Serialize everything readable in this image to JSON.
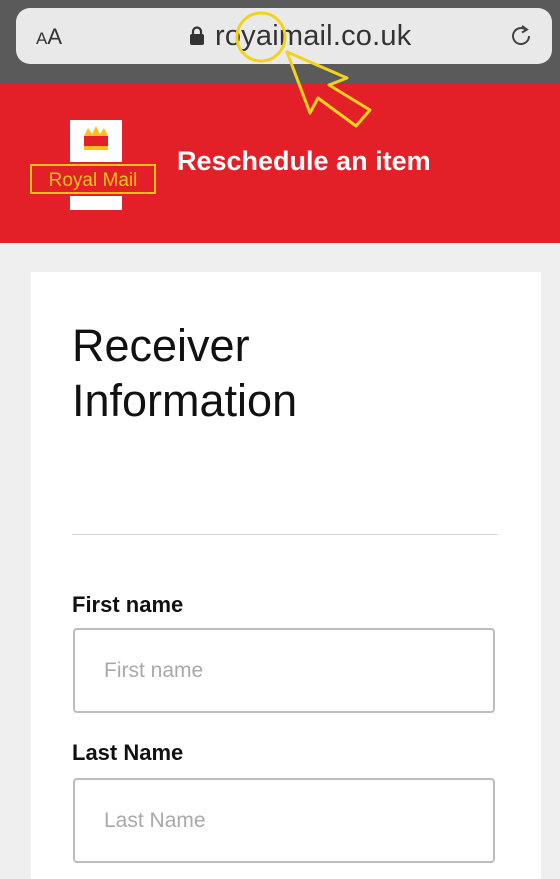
{
  "browser": {
    "text_size_label": "AA",
    "url": "royaimail.co.uk"
  },
  "header": {
    "logo_text": "Royal Mail",
    "title": "Reschedule an item"
  },
  "form": {
    "title_line1": "Receiver",
    "title_line2": "Information",
    "fields": [
      {
        "label": "First name",
        "placeholder": "First name",
        "value": ""
      },
      {
        "label": "Last Name",
        "placeholder": "Last Name",
        "value": ""
      }
    ]
  },
  "colors": {
    "brand_red": "#e32028",
    "brand_yellow": "#f6c21b",
    "annotation_yellow": "#f3d21e"
  },
  "icons": [
    "lock-icon",
    "reload-icon",
    "crown-icon",
    "pointer-arrow-icon",
    "highlight-circle-icon"
  ]
}
